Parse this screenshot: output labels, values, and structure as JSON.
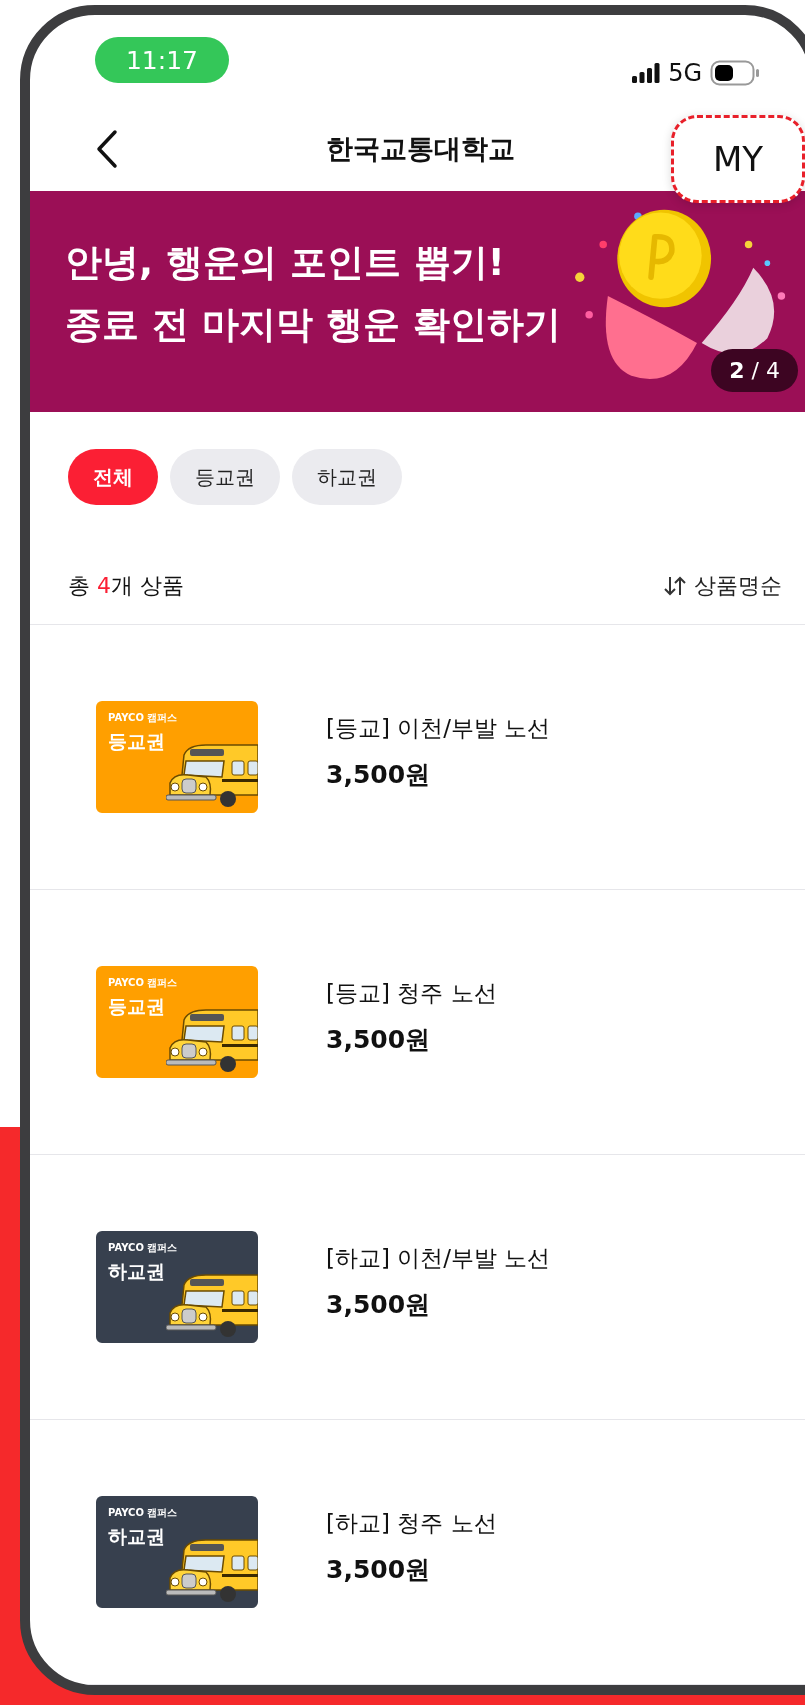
{
  "status_bar": {
    "time": "11:17",
    "network": "5G"
  },
  "nav": {
    "title": "한국교통대학교",
    "my_button": "MY"
  },
  "banner": {
    "lines": [
      "안녕, 행운의 포인트 뽑기!",
      "종료 전 마지막 행운 확인하기"
    ],
    "counter": "**2** / 4"
  },
  "filters": [
    {
      "label": "전체",
      "selected": true
    },
    {
      "label": "등교권",
      "selected": false
    },
    {
      "label": "하교권",
      "selected": false
    }
  ],
  "summary": {
    "prefix": "총 ",
    "count": "4",
    "suffix": "개 상품"
  },
  "sort": {
    "label": "상품명순"
  },
  "products": [
    {
      "thumb_brand": "PAYCO 캠퍼스",
      "thumb_label": "등교권",
      "color": "#ff9f00",
      "title": "[등교] 이천/부발 노선",
      "price": "3,500원"
    },
    {
      "thumb_brand": "PAYCO 캠퍼스",
      "thumb_label": "등교권",
      "color": "#ff9f00",
      "title": "[등교] 청주 노선",
      "price": "3,500원"
    },
    {
      "thumb_brand": "PAYCO 캠퍼스",
      "thumb_label": "하교권",
      "color": "#37404e",
      "title": "[하교] 이천/부발 노선",
      "price": "3,500원"
    },
    {
      "thumb_brand": "PAYCO 캠퍼스",
      "thumb_label": "하교권",
      "color": "#37404e",
      "title": "[하교] 청주 노선",
      "price": "3,500원"
    }
  ]
}
